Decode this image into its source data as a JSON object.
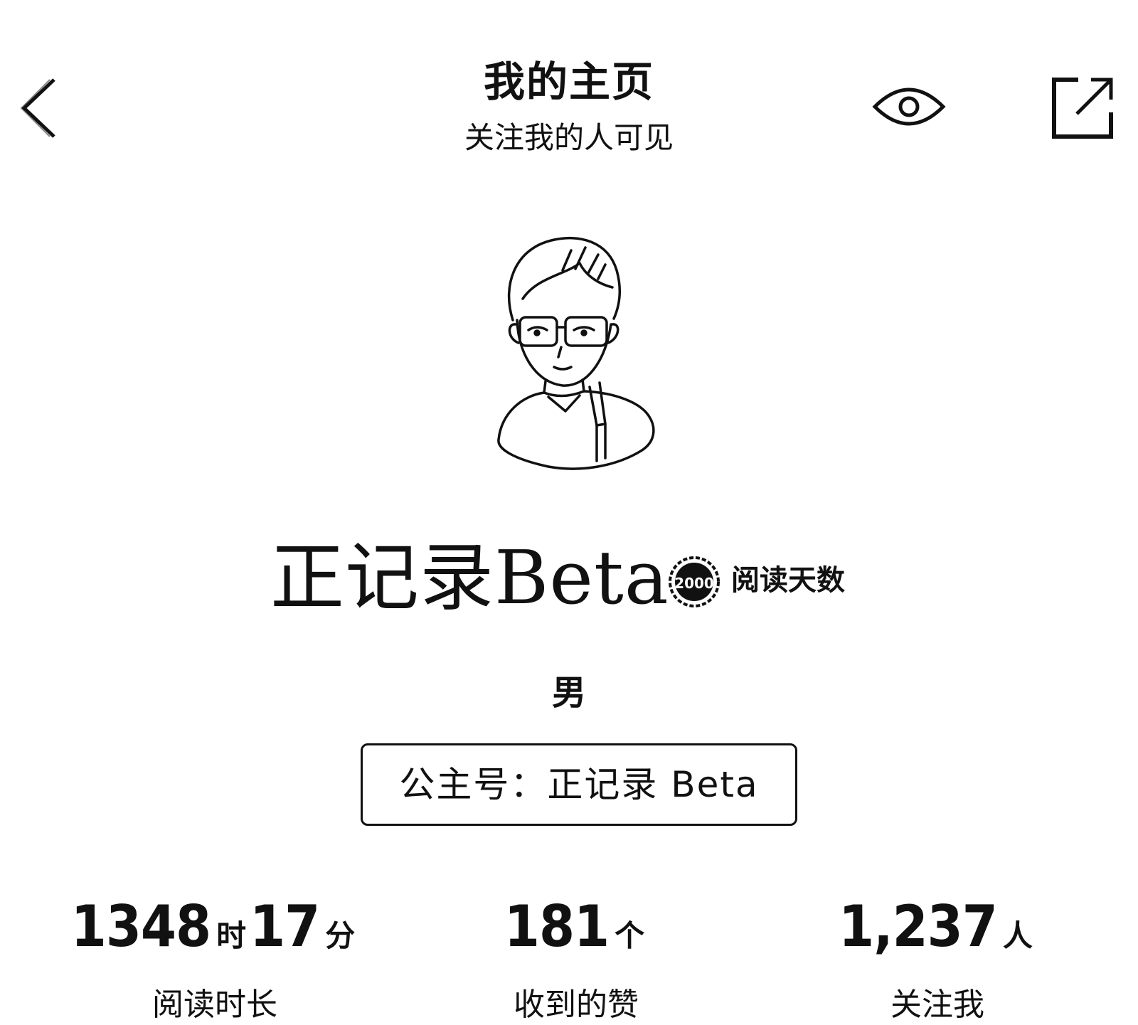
{
  "header": {
    "title": "我的主页",
    "subtitle": "关注我的人可见"
  },
  "icons": {
    "back": "chevron-left-icon",
    "visibility": "eye-icon",
    "share": "share-external-icon"
  },
  "profile": {
    "name": "正记录Beta",
    "badge_number": "2000",
    "badge_label": "阅读天数",
    "gender": "男",
    "wechat_label": "公主号：",
    "wechat_value": "正记录 Beta"
  },
  "stats": {
    "reading_time": {
      "hours": "1348",
      "hours_unit": "时",
      "minutes": "17",
      "minutes_unit": "分",
      "label": "阅读时长"
    },
    "likes": {
      "value": "181",
      "unit": "个",
      "label": "收到的赞"
    },
    "followers": {
      "value": "1,237",
      "unit": "人",
      "label": "关注我"
    }
  }
}
